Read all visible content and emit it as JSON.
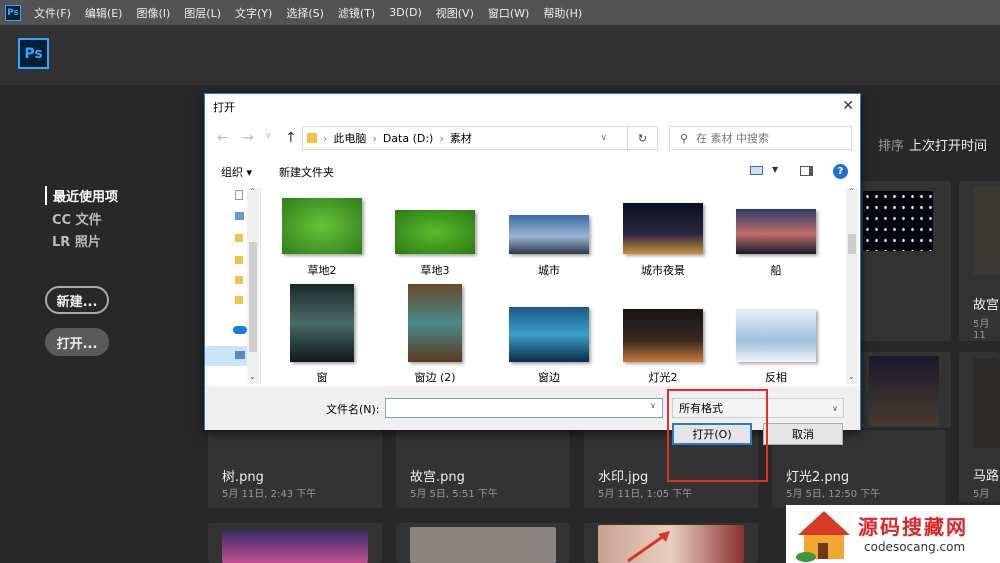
{
  "app": {
    "logo_mini": "Ps",
    "logo": "Ps"
  },
  "menu": [
    "文件(F)",
    "编辑(E)",
    "图像(I)",
    "图层(L)",
    "文字(Y)",
    "选择(S)",
    "滤镜(T)",
    "3D(D)",
    "视图(V)",
    "窗口(W)",
    "帮助(H)"
  ],
  "sidebar": {
    "recent": "最近使用项",
    "cc": "CC 文件",
    "lr": "LR 照片",
    "new_btn": "新建...",
    "open_btn": "打开..."
  },
  "sort": {
    "label": "排序",
    "value": "上次打开时间"
  },
  "cards": [
    {
      "name": "树.png",
      "date": "5月 11日, 2:43 下午"
    },
    {
      "name": "故宫.png",
      "date": "5月 5日, 5:51 下午"
    },
    {
      "name": "水印.jpg",
      "date": "5月 11日, 1:05 下午"
    },
    {
      "name": "灯光2.png",
      "date": "5月 5日, 12:50 下午"
    },
    {
      "name": "马路",
      "date": "5月"
    },
    {
      "name": "故宫",
      "date": "5月 11"
    }
  ],
  "dialog": {
    "title": "打开",
    "breadcrumb": [
      "此电脑",
      "Data (D:)",
      "素材"
    ],
    "search_placeholder": "在 素材 中搜索",
    "organize": "组织 ▾",
    "new_folder": "新建文件夹",
    "files": [
      "草地2",
      "草地3",
      "城市",
      "城市夜景",
      "船",
      "窗",
      "窗边 (2)",
      "窗边",
      "灯光2",
      "反相"
    ],
    "filename_label": "文件名(N):",
    "filename_value": "",
    "filter": "所有格式",
    "open": "打开(O)",
    "cancel": "取消"
  },
  "watermark": {
    "title": "源码搜藏网",
    "url": "codesocang.com"
  }
}
